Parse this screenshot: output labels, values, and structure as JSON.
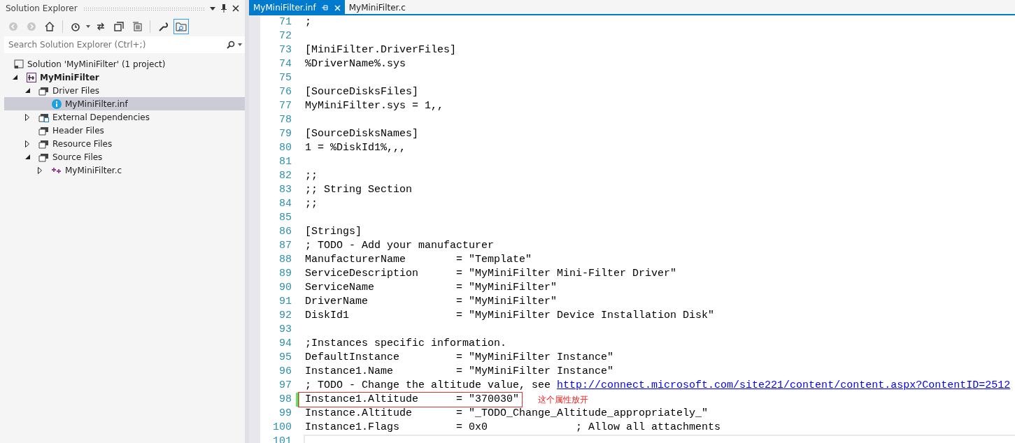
{
  "solution_explorer": {
    "title": "Solution Explorer",
    "search": {
      "placeholder": "Search Solution Explorer (Ctrl+;)"
    },
    "tree": [
      {
        "label": "Solution 'MyMiniFilter' (1 project)",
        "kind": "solution",
        "selected": false,
        "children": [
          {
            "label": "MyMiniFilter",
            "kind": "project",
            "selected": false,
            "expanded": true,
            "children": [
              {
                "label": "Driver Files",
                "kind": "folder",
                "selected": false,
                "expanded": true,
                "children": [
                  {
                    "label": "MyMiniFilter.inf",
                    "kind": "info",
                    "selected": true
                  }
                ]
              },
              {
                "label": "External Dependencies",
                "kind": "external",
                "selected": false,
                "expanded": false
              },
              {
                "label": "Header Files",
                "kind": "folder",
                "selected": false
              },
              {
                "label": "Resource Files",
                "kind": "folder",
                "selected": false,
                "expanded": false
              },
              {
                "label": "Source Files",
                "kind": "folder",
                "selected": false,
                "expanded": true,
                "children": [
                  {
                    "label": "MyMiniFilter.c",
                    "kind": "cpp",
                    "selected": false,
                    "expanded": false
                  }
                ]
              }
            ]
          }
        ]
      }
    ]
  },
  "tabs": [
    {
      "label": "MyMiniFilter.inf",
      "selected": true
    },
    {
      "label": "MyMiniFilter.c",
      "selected": false
    }
  ],
  "editor": {
    "lines": [
      {
        "number": "71",
        "text": ";"
      },
      {
        "number": "72"
      },
      {
        "number": "73",
        "text": "[MiniFilter.DriverFiles]"
      },
      {
        "number": "74",
        "text": "%DriverName%.sys"
      },
      {
        "number": "75"
      },
      {
        "number": "76",
        "text": "[SourceDisksFiles]"
      },
      {
        "number": "77",
        "text": "MyMiniFilter.sys = 1,,"
      },
      {
        "number": "78"
      },
      {
        "number": "79",
        "text": "[SourceDisksNames]"
      },
      {
        "number": "80",
        "text": "1 = %DiskId1%,,,"
      },
      {
        "number": "81"
      },
      {
        "number": "82",
        "text": ";;"
      },
      {
        "number": "83",
        "text": ";; String Section"
      },
      {
        "number": "84",
        "text": ";;"
      },
      {
        "number": "85"
      },
      {
        "number": "86",
        "text": "[Strings]"
      },
      {
        "number": "87",
        "text": "; TODO - Add your manufacturer"
      },
      {
        "number": "88",
        "text": "ManufacturerName        = \"Template\""
      },
      {
        "number": "89",
        "text": "ServiceDescription      = \"MyMiniFilter Mini-Filter Driver\""
      },
      {
        "number": "90",
        "text": "ServiceName             = \"MyMiniFilter\""
      },
      {
        "number": "91",
        "text": "DriverName              = \"MyMiniFilter\""
      },
      {
        "number": "92",
        "text": "DiskId1                 = \"MyMiniFilter Device Installation Disk\""
      },
      {
        "number": "93"
      },
      {
        "number": "94",
        "text": ";Instances specific information."
      },
      {
        "number": "95",
        "text": "DefaultInstance         = \"MyMiniFilter Instance\""
      },
      {
        "number": "96",
        "text": "Instance1.Name          = \"MyMiniFilter Instance\""
      },
      {
        "number": "97",
        "text": "; TODO - Change the altitude value, see ",
        "link": "http://connect.microsoft.com/site221/content/content.aspx?ContentID=2512"
      },
      {
        "number": "98",
        "text": "Instance1.Altitude      = \"370030\"",
        "changed": true,
        "note": "这个属性放开"
      },
      {
        "number": "99",
        "text": "Instance.Altitude       = \"_TODO_Change_Altitude_appropriately_\""
      },
      {
        "number": "100",
        "text": "Instance1.Flags         = 0x0              ; Allow all attachments"
      },
      {
        "number": "101",
        "current": true
      }
    ]
  }
}
